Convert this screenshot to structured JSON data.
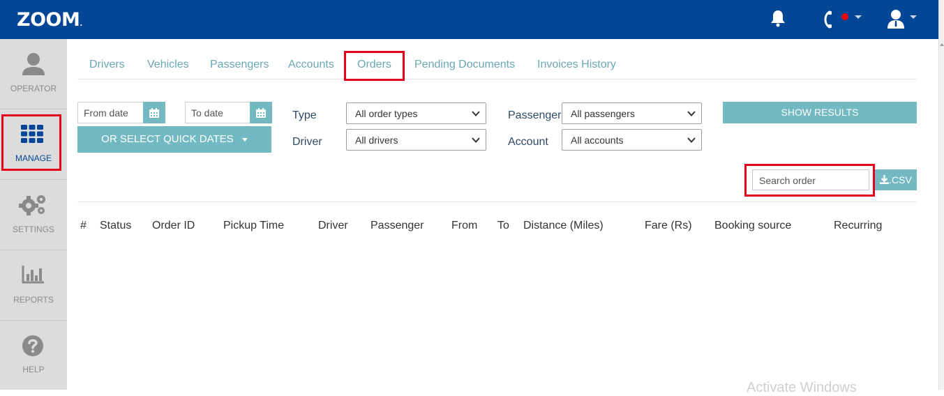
{
  "app": {
    "logo": "ZOOM",
    "logo_mark": "."
  },
  "sidebar": {
    "items": [
      {
        "label": "OPERATOR"
      },
      {
        "label": "MANAGE"
      },
      {
        "label": "SETTINGS"
      },
      {
        "label": "REPORTS"
      },
      {
        "label": "HELP"
      }
    ]
  },
  "tabs": [
    {
      "label": "Drivers"
    },
    {
      "label": "Vehicles"
    },
    {
      "label": "Passengers"
    },
    {
      "label": "Accounts"
    },
    {
      "label": "Orders"
    },
    {
      "label": "Pending Documents"
    },
    {
      "label": "Invoices History"
    }
  ],
  "filters": {
    "from_date_placeholder": "From date",
    "to_date_placeholder": "To date",
    "quick_dates_label": "OR SELECT QUICK DATES",
    "type_label": "Type",
    "type_value": "All order types",
    "driver_label": "Driver",
    "driver_value": "All drivers",
    "passenger_label": "Passenger",
    "passenger_value": "All passengers",
    "account_label": "Account",
    "account_value": "All accounts",
    "show_results_label": "SHOW RESULTS"
  },
  "search": {
    "placeholder": "Search order",
    "csv_label": ".CSV"
  },
  "table": {
    "columns": [
      "#",
      "Status",
      "Order ID",
      "Pickup Time",
      "Driver",
      "Passenger",
      "From",
      "To",
      "Distance (Miles)",
      "Fare (Rs)",
      "Booking source",
      "Recurring"
    ]
  },
  "watermark": "Activate Windows",
  "colors": {
    "brand": "#034695",
    "accent": "#72b9c1",
    "highlight": "#e3001b",
    "tab_text": "#6aa7b5",
    "status_dot": "#e30613"
  }
}
